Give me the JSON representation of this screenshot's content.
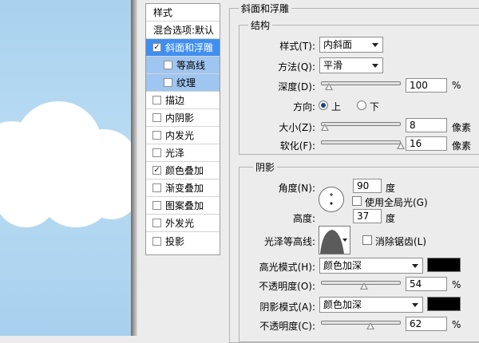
{
  "style_list": {
    "header_style": "样式",
    "header_blend": "混合选项:默认",
    "items": [
      {
        "label": "斜面和浮雕",
        "checked": true
      },
      {
        "label": "等高线",
        "checked": false
      },
      {
        "label": "纹理",
        "checked": false
      },
      {
        "label": "描边",
        "checked": false
      },
      {
        "label": "内阴影",
        "checked": false
      },
      {
        "label": "内发光",
        "checked": false
      },
      {
        "label": "光泽",
        "checked": false
      },
      {
        "label": "颜色叠加",
        "checked": true
      },
      {
        "label": "渐变叠加",
        "checked": false
      },
      {
        "label": "图案叠加",
        "checked": false
      },
      {
        "label": "外发光",
        "checked": false
      },
      {
        "label": "投影",
        "checked": false
      }
    ]
  },
  "bevel": {
    "group_title": "斜面和浮雕",
    "structure_title": "结构",
    "style_label": "样式(T):",
    "style_value": "内斜面",
    "technique_label": "方法(Q):",
    "technique_value": "平滑",
    "depth_label": "深度(D):",
    "depth_value": "100",
    "depth_unit": "%",
    "depth_fraction": 0.1,
    "direction_label": "方向:",
    "direction_up": "上",
    "direction_down": "下",
    "size_label": "大小(Z):",
    "size_value": "8",
    "size_unit": "像素",
    "size_fraction": 0.05,
    "soften_label": "软化(F):",
    "soften_value": "16",
    "soften_unit": "像素",
    "soften_fraction": 1.0
  },
  "shading": {
    "group_title": "阴影",
    "angle_label": "角度(N):",
    "angle_value": "90",
    "angle_unit": "度",
    "global_light_label": "使用全局光(G)",
    "altitude_label": "高度:",
    "altitude_value": "37",
    "altitude_unit": "度",
    "gloss_contour_label": "光泽等高线:",
    "anti_aliased_label": "消除锯齿(L)",
    "highlight_mode_label": "高光模式(H):",
    "highlight_mode_value": "颜色加深",
    "highlight_color": "#000000",
    "highlight_opacity_label": "不透明度(O):",
    "highlight_opacity_value": "54",
    "highlight_opacity_unit": "%",
    "highlight_opacity_fraction": 0.54,
    "shadow_mode_label": "阴影模式(A):",
    "shadow_mode_value": "颜色加深",
    "shadow_color": "#000000",
    "shadow_opacity_label": "不透明度(C):",
    "shadow_opacity_value": "62",
    "shadow_opacity_unit": "%",
    "shadow_opacity_fraction": 0.62
  },
  "colors": {
    "selection": "#3f8ff0",
    "sub_selection": "#9fc5f1",
    "sky": "#b9dcf3"
  }
}
